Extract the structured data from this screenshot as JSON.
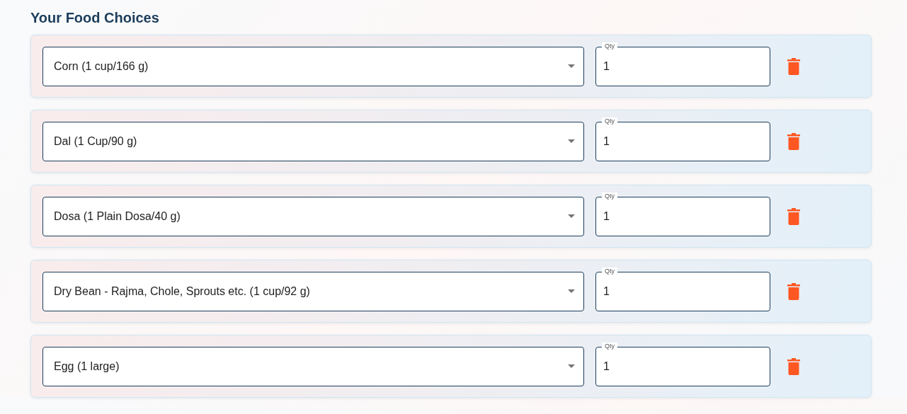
{
  "title": "Your Food Choices",
  "items": [
    {
      "food": "Corn (1 cup/166 g)",
      "qty_label": "Qty",
      "qty": "1"
    },
    {
      "food": "Dal (1 Cup/90 g)",
      "qty_label": "Qty",
      "qty": "1"
    },
    {
      "food": "Dosa (1 Plain Dosa/40 g)",
      "qty_label": "Qty",
      "qty": "1"
    },
    {
      "food": "Dry Bean - Rajma, Chole, Sprouts etc. (1 cup/92 g)",
      "qty_label": "Qty",
      "qty": "1"
    },
    {
      "food": "Egg (1 large)",
      "qty_label": "Qty",
      "qty": "1"
    }
  ]
}
